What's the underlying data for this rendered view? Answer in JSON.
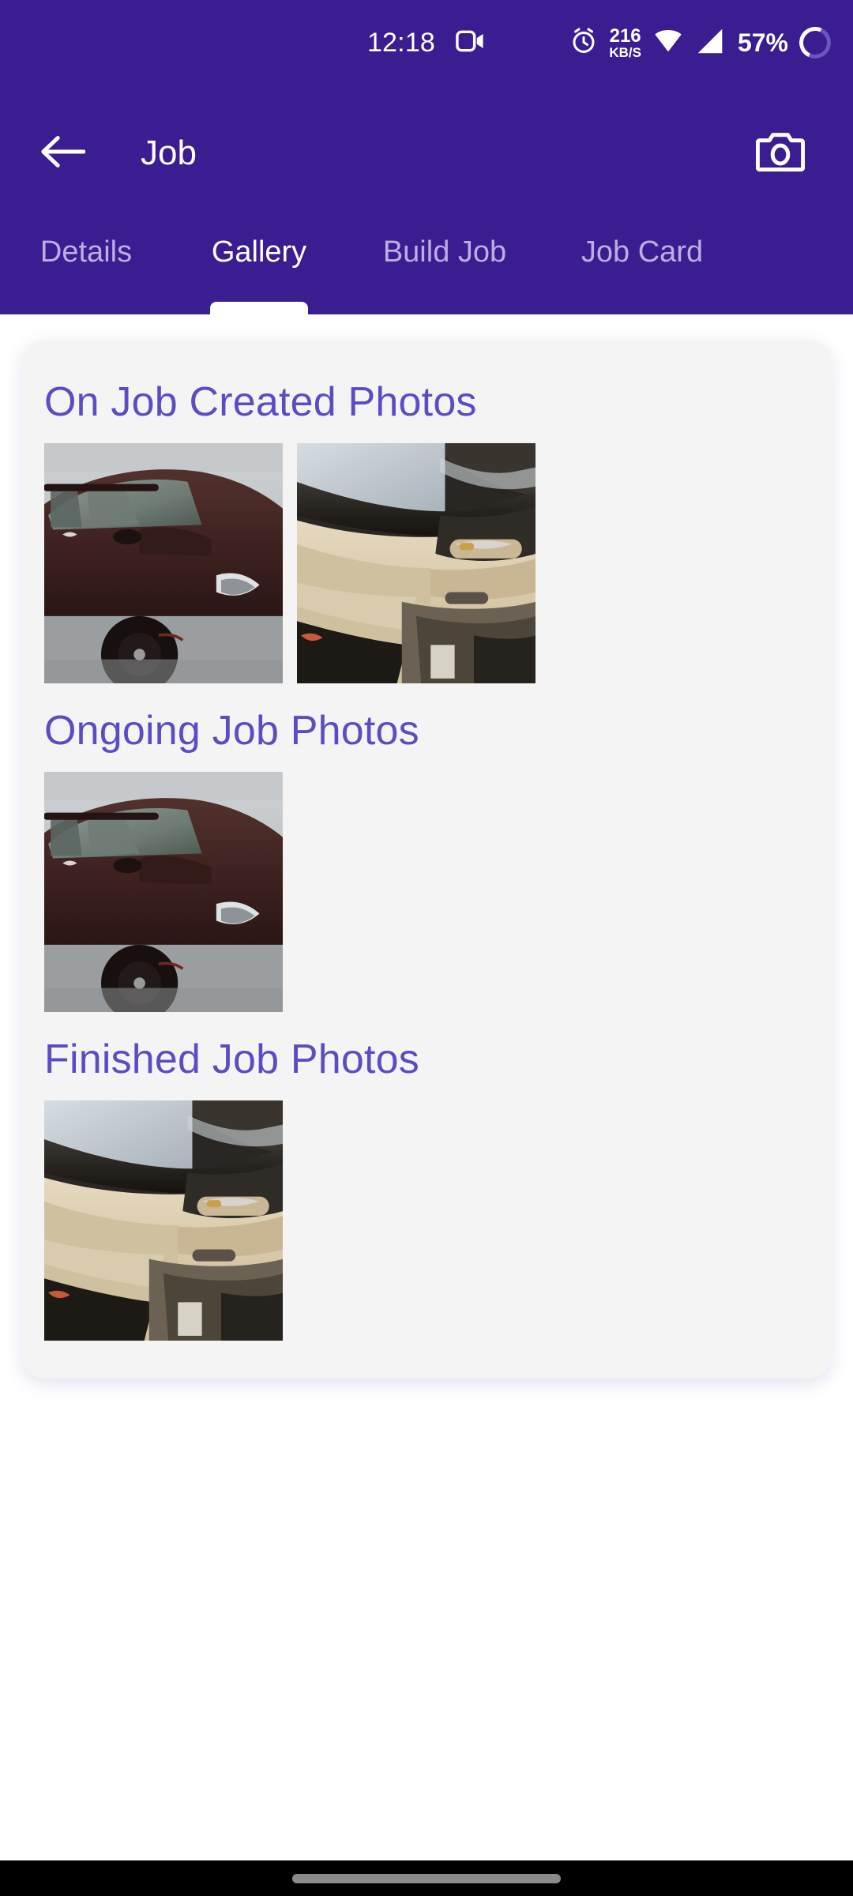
{
  "status_bar": {
    "time": "12:18",
    "screen_record_icon": "video-camera-icon",
    "alarm_icon": "alarm-clock-icon",
    "net_speed_value": "216",
    "net_speed_unit": "KB/S",
    "wifi_icon": "wifi-icon",
    "signal_icon": "cellular-signal-icon",
    "battery_percent": "57%",
    "battery_icon": "battery-ring-icon"
  },
  "app_bar": {
    "back_icon": "arrow-left-icon",
    "title": "Job",
    "camera_icon": "camera-icon"
  },
  "tabs": {
    "active_index": 1,
    "items": [
      {
        "label": "Details"
      },
      {
        "label": "Gallery"
      },
      {
        "label": "Build Job"
      },
      {
        "label": "Job Card"
      }
    ]
  },
  "gallery": {
    "sections": [
      {
        "title": "On Job Created Photos",
        "photos": [
          {
            "alt": "car-exterior-front-left-maroon",
            "kind": "exterior"
          },
          {
            "alt": "car-interior-beige-door-panel",
            "kind": "interior"
          }
        ]
      },
      {
        "title": "Ongoing Job Photos",
        "photos": [
          {
            "alt": "car-exterior-front-left-maroon",
            "kind": "exterior"
          }
        ]
      },
      {
        "title": "Finished Job Photos",
        "photos": [
          {
            "alt": "car-interior-beige-door-panel",
            "kind": "interior"
          }
        ]
      }
    ]
  },
  "nav_bar": {
    "gesture_pill": "home-gesture-pill"
  },
  "colors": {
    "primary": "#3A1D91",
    "accent_heading": "#5B4CC4",
    "tab_inactive": "#BCAEE4",
    "card_bg": "#F4F4F4",
    "page_bg": "#FFFFFF"
  }
}
